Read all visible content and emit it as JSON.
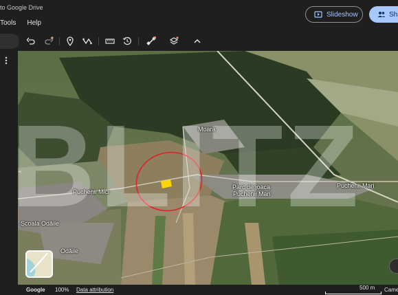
{
  "header": {
    "saved_text": "to Google Drive",
    "menu": [
      "Tools",
      "Help"
    ],
    "slideshow_label": "Slideshow",
    "share_label": "Sha"
  },
  "toolbar": {
    "icons": [
      "undo-icon",
      "redo-icon",
      "placemark-icon",
      "path-icon",
      "ruler-icon",
      "historical-imagery-icon",
      "satellite-icon",
      "layers-icon",
      "chevron-up-icon"
    ]
  },
  "map": {
    "places": {
      "moara": "Moara",
      "puchenii_mici": "Puchenii Mici",
      "parc": "Parc de joaca",
      "parc2": "Puchenii Mari",
      "puchenii_mari": "Puchenii Mari",
      "scoala": "Școala Odăile",
      "odaile": "Odăile"
    },
    "watermark": "BLITZ"
  },
  "statusbar": {
    "brand": "Google",
    "zoom": "100%",
    "attribution": "Data attribution",
    "scale": "500 m",
    "camera": "Camera"
  }
}
